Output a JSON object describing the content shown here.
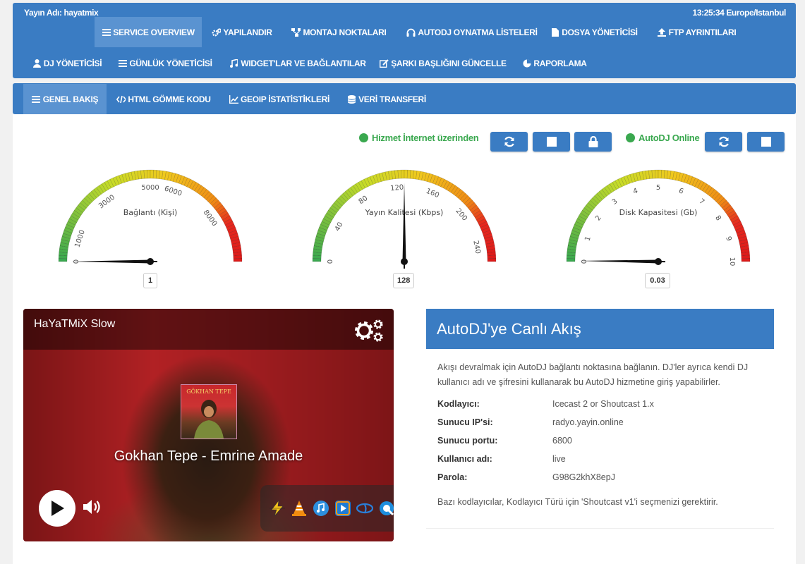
{
  "header": {
    "broadcast_name": "Yayın Adı: hayatmix",
    "clock": "13:25:34 Europe/Istanbul"
  },
  "nav": {
    "service_overview": "SERVICE OVERVIEW",
    "configure": "YAPILANDIR",
    "mount_points": "MONTAJ NOKTALARI",
    "autodj_playlists": "AUTODJ OYNATMA LİSTELERİ",
    "file_manager": "DOSYA YÖNETİCİSİ",
    "ftp_settings": "FTP AYRINTILARI",
    "dj_manager": "DJ YÖNETİCİSİ",
    "log_manager": "GÜNLÜK YÖNETİCİSİ",
    "widgets": "WIDGET'LAR VE BAĞLANTILAR",
    "update_title": "ŞARKI BAŞLIĞINI GÜNCELLE",
    "reports": "RAPORLAMA"
  },
  "subnav": {
    "overview": "GENEL BAKIŞ",
    "embed": "HTML GÖMME KODU",
    "geoip": "GEOIP İSTATİSTİKLERİ",
    "transfer": "VERİ TRANSFERİ"
  },
  "status": {
    "service": "Hizmet İnternet üzerinden",
    "autodj": "AutoDJ Online",
    "color": "#3aa84f"
  },
  "gauges": [
    {
      "title": "Bağlantı (Kişi)",
      "min": 0,
      "max": 10000,
      "value": 1,
      "display": "1",
      "ticks": [
        "0",
        "1000",
        "3000",
        "5000",
        "6000",
        "8000"
      ]
    },
    {
      "title": "Yayın Kalitesi (Kbps)",
      "min": 0,
      "max": 256,
      "value": 128,
      "display": "128",
      "ticks": [
        "0",
        "40",
        "80",
        "120",
        "160",
        "200",
        "240"
      ]
    },
    {
      "title": "Disk Kapasitesi (Gb)",
      "min": 0,
      "max": 10,
      "value": 0.03,
      "display": "0.03",
      "ticks": [
        "0",
        "1",
        "2",
        "3",
        "4",
        "5",
        "6",
        "7",
        "8",
        "9",
        "10"
      ]
    }
  ],
  "player": {
    "station": "HaYaTMiX Slow",
    "track": "Gokhan Tepe - Emrine Amade",
    "cover_text": "GÖKHAN TEPE"
  },
  "autodj_panel": {
    "title": "AutoDJ'ye Canlı Akış",
    "description": "Akışı devralmak için AutoDJ bağlantı noktasına bağlanın. DJ'ler ayrıca kendi DJ kullanıcı adı ve şifresini kullanarak bu AutoDJ hizmetine giriş yapabilirler.",
    "rows": [
      {
        "label": "Kodlayıcı:",
        "value": "Icecast 2 or Shoutcast 1.x"
      },
      {
        "label": "Sunucu IP'si:",
        "value": "radyo.yayin.online"
      },
      {
        "label": "Sunucu portu:",
        "value": "6800"
      },
      {
        "label": "Kullanıcı adı:",
        "value": "live"
      },
      {
        "label": "Parola:",
        "value": "G98G2khX8epJ"
      }
    ],
    "note": "Bazı kodlayıcılar, Kodlayıcı Türü için 'Shoutcast v1'i seçmenizi gerektirir."
  },
  "colors": {
    "primary": "#3a7cc3",
    "active": "#5a93d1",
    "success": "#3aa84f"
  }
}
